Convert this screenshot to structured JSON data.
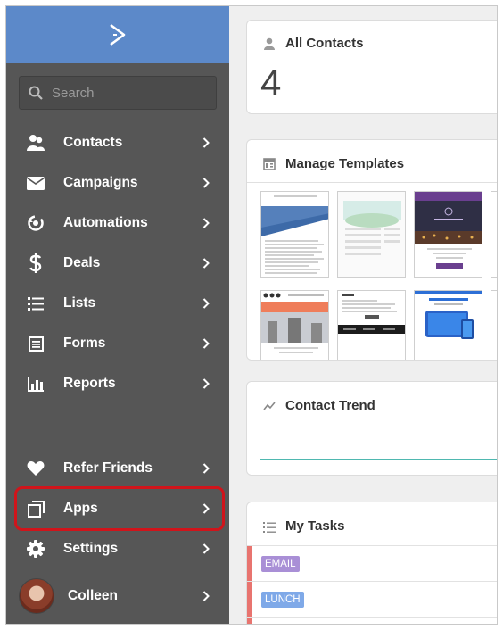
{
  "sidebar": {
    "search_placeholder": "Search",
    "items": [
      {
        "label": "Contacts",
        "icon": "contacts-icon"
      },
      {
        "label": "Campaigns",
        "icon": "envelope-icon"
      },
      {
        "label": "Automations",
        "icon": "automations-icon"
      },
      {
        "label": "Deals",
        "icon": "dollar-icon"
      },
      {
        "label": "Lists",
        "icon": "list-icon"
      },
      {
        "label": "Forms",
        "icon": "form-icon"
      },
      {
        "label": "Reports",
        "icon": "bar-chart-icon"
      },
      {
        "label": "Refer Friends",
        "icon": "heart-icon"
      },
      {
        "label": "Apps",
        "icon": "apps-icon"
      },
      {
        "label": "Settings",
        "icon": "gear-icon"
      }
    ],
    "user": {
      "name": "Colleen"
    }
  },
  "main": {
    "all_contacts": {
      "title": "All Contacts",
      "count": "4"
    },
    "templates": {
      "title": "Manage Templates"
    },
    "trend": {
      "title": "Contact Trend"
    },
    "tasks": {
      "title": "My Tasks",
      "items": [
        {
          "badge": "EMAIL",
          "color": "#a98fd6"
        },
        {
          "badge": "LUNCH",
          "color": "#7fa9e8"
        }
      ]
    }
  },
  "colors": {
    "sidebar_bg": "#565656",
    "logo_bar": "#5c89c9",
    "highlight": "#d0141b",
    "trend_line": "#4fb8b0"
  }
}
